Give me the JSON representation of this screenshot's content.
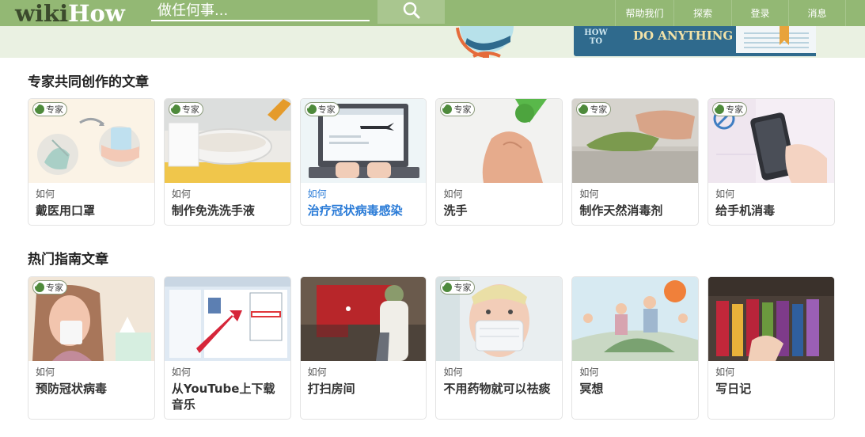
{
  "header": {
    "logo_wiki": "wiki",
    "logo_how": "How",
    "search_placeholder": "做任何事...",
    "nav": [
      "帮助我们",
      "探索",
      "登录",
      "消息"
    ]
  },
  "banner": {
    "book_left": "HOW TO",
    "book_title": "DO ANYTHING"
  },
  "colors": {
    "header_bg": "#93b874",
    "link_blue": "#2a7bd7",
    "badge_green": "#4e8a3b"
  },
  "expert_section": {
    "title": "专家共同创作的文章",
    "cards": [
      {
        "badge": "专家",
        "how": "如何",
        "title": "戴医用口罩"
      },
      {
        "badge": "专家",
        "how": "如何",
        "title": "制作免洗洗手液"
      },
      {
        "badge": "专家",
        "how": "如何",
        "title": "治疗冠状病毒感染"
      },
      {
        "badge": "专家",
        "how": "如何",
        "title": "洗手"
      },
      {
        "badge": "专家",
        "how": "如何",
        "title": "制作天然消毒剂"
      },
      {
        "badge": "专家",
        "how": "如何",
        "title": "给手机消毒"
      }
    ]
  },
  "popular_section": {
    "title": "热门指南文章",
    "cards": [
      {
        "badge": "专家",
        "how": "如何",
        "title": "预防冠状病毒"
      },
      {
        "how": "如何",
        "title": "从YouTube上下载音乐"
      },
      {
        "how": "如何",
        "title": "打扫房间"
      },
      {
        "badge": "专家",
        "how": "如何",
        "title": "不用药物就可以祛痰"
      },
      {
        "how": "如何",
        "title": "冥想"
      },
      {
        "how": "如何",
        "title": "写日记"
      }
    ]
  }
}
